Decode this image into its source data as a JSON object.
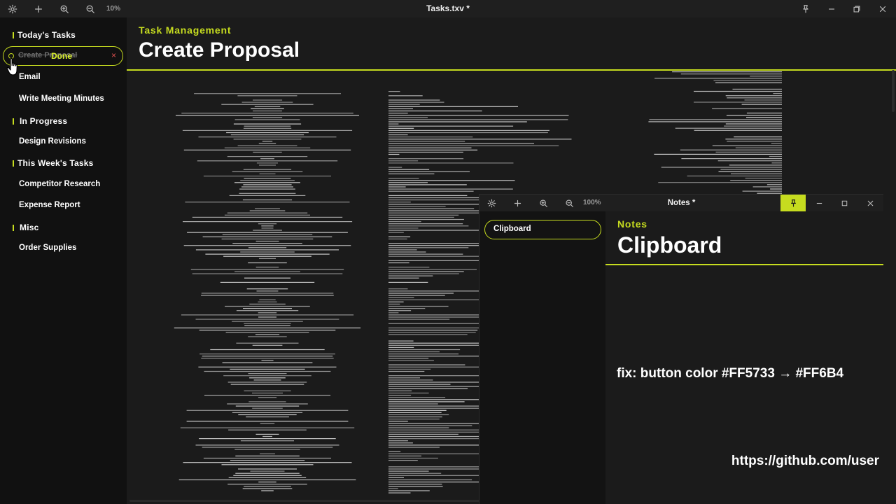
{
  "window": {
    "title": "Tasks.txv *",
    "zoom": "10%"
  },
  "sidebar": {
    "sections": [
      {
        "header": "Today's Tasks",
        "items": [
          "Create Proposal",
          "Email",
          "Write Meeting Minutes"
        ]
      },
      {
        "header": "In Progress",
        "items": [
          "Design Revisions"
        ]
      },
      {
        "header": "This Week's Tasks",
        "items": [
          "Competitor Research",
          "Expense Report"
        ]
      },
      {
        "header": "Misc",
        "items": [
          "Order Supplies"
        ]
      }
    ],
    "drag_pill": {
      "label_under": "Create Proposal",
      "done_label": "Done",
      "close_glyph": "×"
    }
  },
  "main": {
    "subtitle": "Task Management",
    "title": "Create Proposal"
  },
  "notes_window": {
    "title": "Notes *",
    "zoom": "100%",
    "sidebar_item": "Clipboard",
    "subtitle": "Notes",
    "title_big": "Clipboard",
    "line1": "fix: button color #FF5733 → #FF6B4",
    "line2": "https://github.com/user"
  },
  "colors": {
    "accent": "#c6dc1f",
    "bg": "#1b1b1b",
    "sidebar_bg": "#111111",
    "close_red": "#e05050"
  },
  "icons": [
    "settings-icon",
    "plus-icon",
    "zoom-in-icon",
    "zoom-out-icon",
    "pin-icon",
    "minimize-icon",
    "restore-icon",
    "close-icon",
    "hand-cursor-icon"
  ]
}
